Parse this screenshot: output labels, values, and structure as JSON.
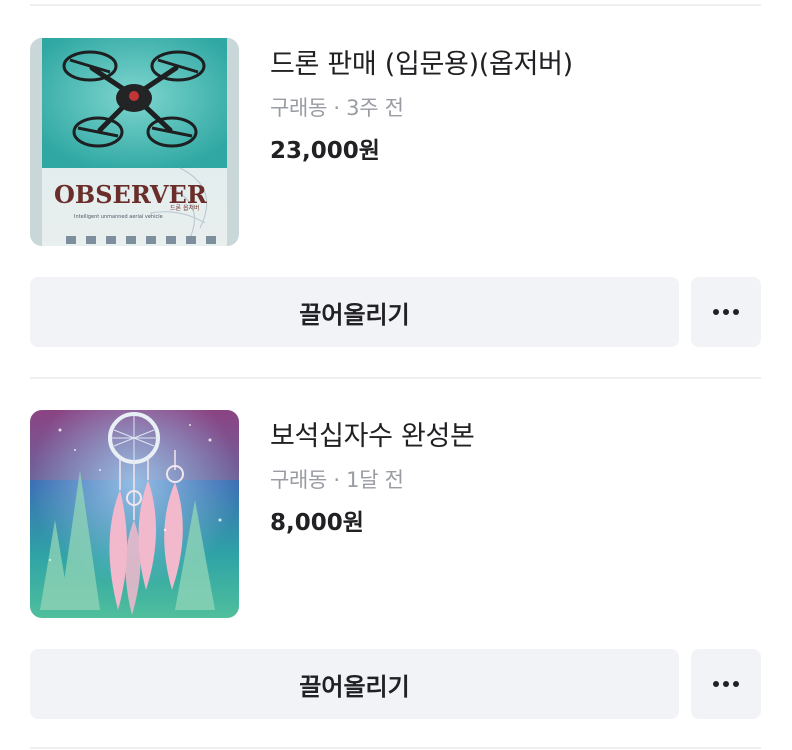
{
  "listings": [
    {
      "title": "드론 판매 (입문용)(옵저버)",
      "meta": "구래동 · 3주 전",
      "price": "23,000원",
      "image_icon": "drone-box-photo",
      "image_text": {
        "brand": "OBSERVER",
        "korean": "드론 옵저버",
        "subtitle": "Intelligent unmanned aerial vehicle"
      },
      "bump_label": "끌어올리기",
      "more_icon": "more-horizontal-icon"
    },
    {
      "title": "보석십자수 완성본",
      "meta": "구래동 · 1달 전",
      "price": "8,000원",
      "image_icon": "dreamcatcher-diamond-painting-photo",
      "bump_label": "끌어올리기",
      "more_icon": "more-horizontal-icon"
    }
  ],
  "colors": {
    "button_bg": "#f2f3f6",
    "text_primary": "#212124",
    "text_secondary": "#9a9ca3",
    "divider": "#eeeff1"
  }
}
